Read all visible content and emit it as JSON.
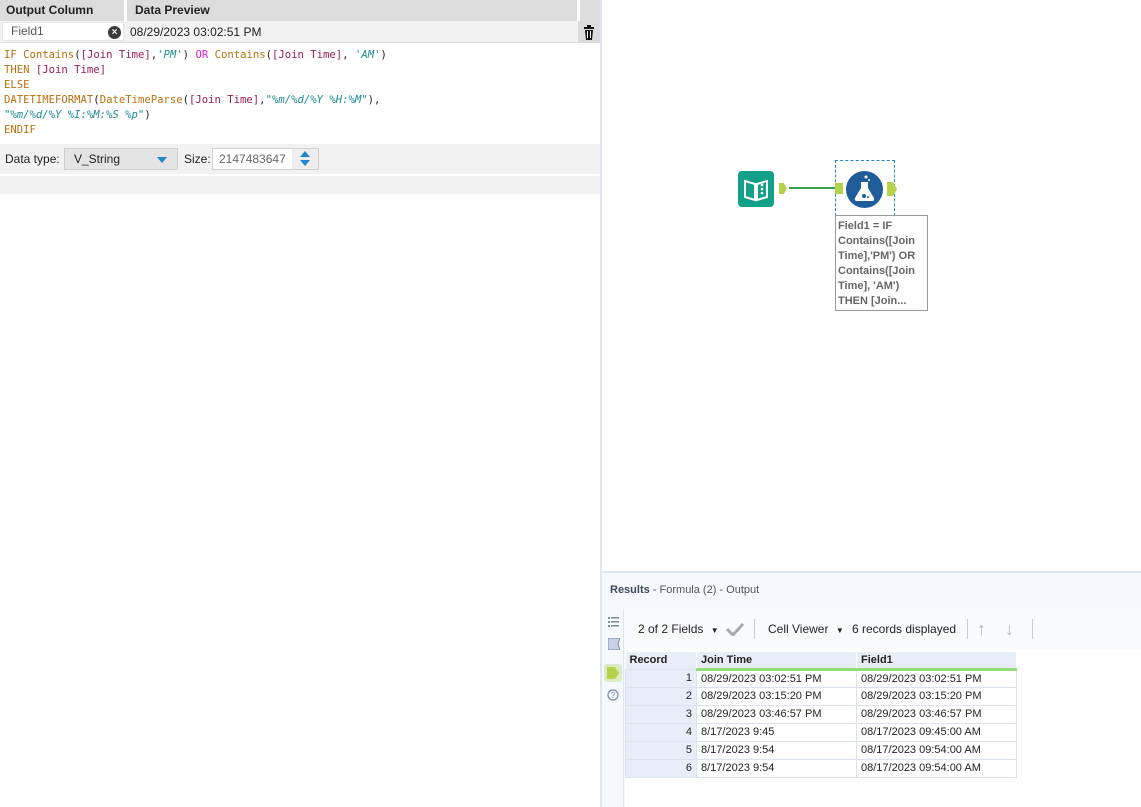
{
  "formula_config": {
    "headers": {
      "output_column": "Output Column",
      "data_preview": "Data Preview"
    },
    "field": {
      "name": "Field1",
      "preview": "08/29/2023 03:02:51 PM"
    },
    "expression_lines": [
      "IF Contains([Join Time],'PM') OR Contains([Join Time], 'AM')",
      "THEN [Join Time]",
      "ELSE",
      "DATETIMEFORMAT(DateTimeParse([Join Time],\"%m/%d/%Y %H:%M\"),",
      "\"%m/%d/%Y %I:%M:%S %p\")",
      "ENDIF"
    ],
    "data_type_label": "Data type:",
    "data_type_value": "V_String",
    "size_label": "Size:",
    "size_value": "2147483647"
  },
  "canvas": {
    "tools": [
      {
        "name": "Input Data",
        "icon": "book-icon",
        "color": "#12a089"
      },
      {
        "name": "Formula",
        "icon": "flask-icon",
        "color": "#1f5c9a"
      }
    ],
    "annotation_lines": [
      "Field1 = IF",
      "Contains([Join",
      "Time],'PM') OR",
      "Contains([Join",
      "Time], 'AM')",
      "THEN [Join..."
    ]
  },
  "results": {
    "title": "Results",
    "subtitle": " - Formula (2) - Output",
    "fields_selector": "2 of 2 Fields",
    "cell_viewer": "Cell Viewer",
    "records_displayed": "6 records displayed",
    "columns": [
      "Record",
      "Join Time",
      "Field1"
    ],
    "rows": [
      [
        "1",
        "08/29/2023 03:02:51 PM",
        "08/29/2023 03:02:51 PM"
      ],
      [
        "2",
        "08/29/2023 03:15:20 PM",
        "08/29/2023 03:15:20 PM"
      ],
      [
        "3",
        "08/29/2023 03:46:57 PM",
        "08/29/2023 03:46:57 PM"
      ],
      [
        "4",
        "8/17/2023 9:45",
        "08/17/2023 09:45:00 AM"
      ],
      [
        "5",
        "8/17/2023 9:54",
        "08/17/2023 09:54:00 AM"
      ],
      [
        "6",
        "8/17/2023 9:54",
        "08/17/2023 09:54:00 AM"
      ]
    ]
  },
  "colors": {
    "accent_blue": "#1e88c8",
    "anchor_green": "#b5d24a",
    "connection_green": "#3aa34a"
  }
}
